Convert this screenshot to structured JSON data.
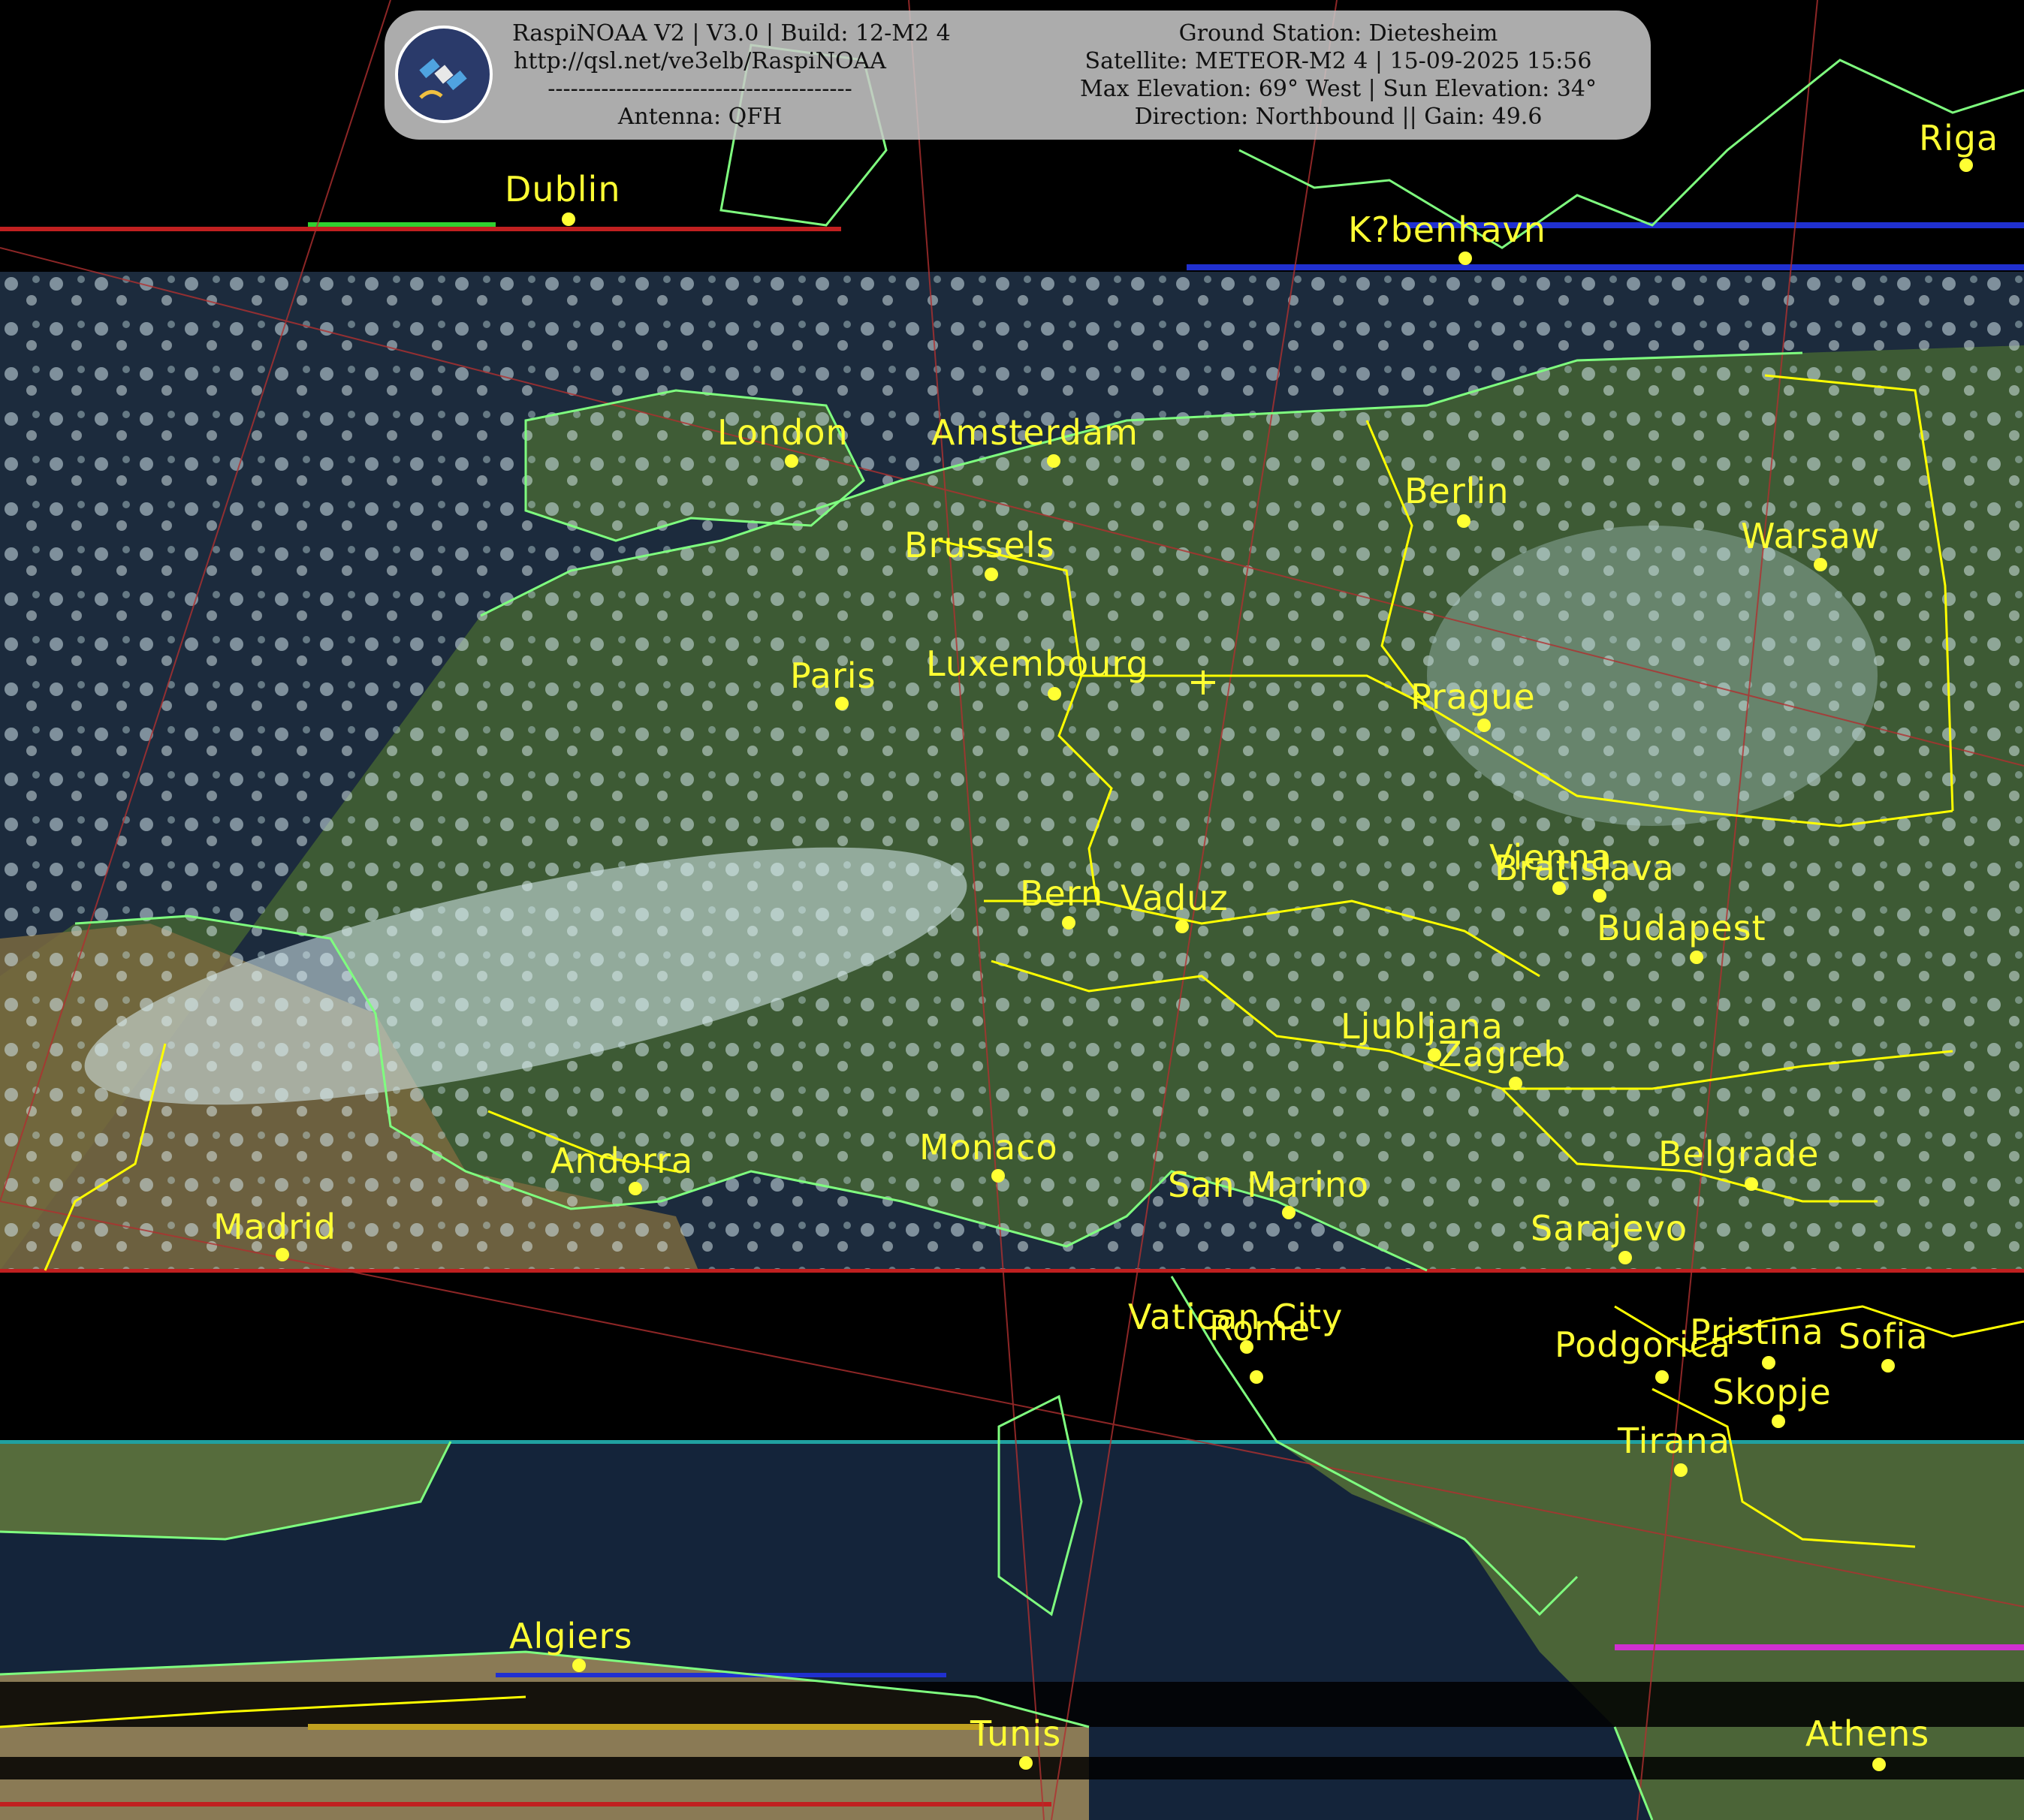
{
  "header": {
    "left_lines": [
      "RaspiNOAA V2 | V3.0 | Build: 12-M2 4",
      "http://qsl.net/ve3elb/RaspiNOAA",
      "----------------------------------------",
      "Antenna: QFH"
    ],
    "right_lines": [
      "Ground Station: Dietesheim",
      "Satellite: METEOR-M2 4 | 15-09-2025 15:56",
      "Max Elevation: 69° West | Sun Elevation: 34°",
      "Direction: Northbound || Gain: 49.6"
    ],
    "logo_icon": "satellite-icon"
  },
  "cities": [
    "Dublin",
    "Riga",
    "K?benhavn",
    "London",
    "Amsterdam",
    "Berlin",
    "Brussels",
    "Warsaw",
    "Paris",
    "Luxembourg",
    "Prague",
    "Vienna",
    "Bratislava",
    "Bern",
    "Vaduz",
    "Budapest",
    "Ljubljana",
    "Zagreb",
    "Andorra",
    "Monaco",
    "San Marino",
    "Belgrade",
    "Madrid",
    "Sarajevo",
    "Vatican City",
    "Rome",
    "Podgorica",
    "Pristina",
    "Sofia",
    "Skopje",
    "Tirana",
    "Algiers",
    "Tunis",
    "Athens"
  ],
  "colors": {
    "label": "#ffff33",
    "coastline": "#7fff7f",
    "border": "#ffff00",
    "grid": "#b03030"
  }
}
